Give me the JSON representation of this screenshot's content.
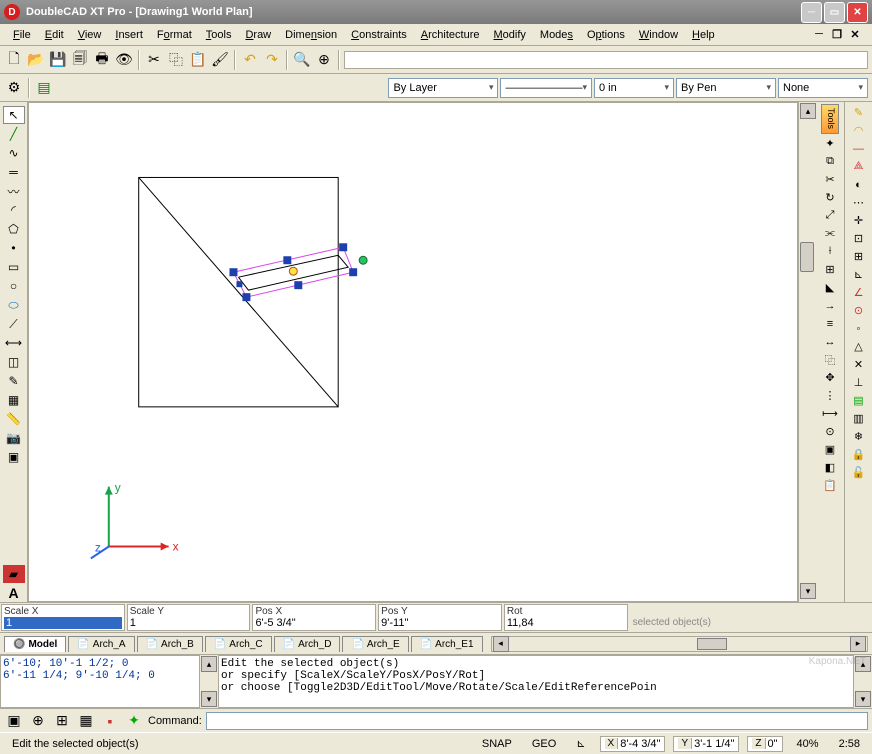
{
  "title": "DoubleCAD XT Pro - [Drawing1 World Plan]",
  "menu": [
    "File",
    "Edit",
    "View",
    "Insert",
    "Format",
    "Tools",
    "Draw",
    "Dimension",
    "Constraints",
    "Architecture",
    "Modify",
    "Modes",
    "Options",
    "Window",
    "Help"
  ],
  "props": {
    "layer": "By Layer",
    "ltype": "———————",
    "lweight": "0 in",
    "pen": "By Pen",
    "style": "None"
  },
  "params": [
    {
      "label": "Scale X",
      "value": "1"
    },
    {
      "label": "Scale Y",
      "value": "1"
    },
    {
      "label": "Pos X",
      "value": "6'-5 3/4\""
    },
    {
      "label": "Pos Y",
      "value": "9'-11\""
    },
    {
      "label": "Rot",
      "value": "11,84"
    }
  ],
  "params_hint": "selected object(s)",
  "tabs": [
    "Model",
    "Arch_A",
    "Arch_B",
    "Arch_C",
    "Arch_D",
    "Arch_E",
    "Arch_E1"
  ],
  "active_tab": "Model",
  "history": [
    "6'-10; 10'-1 1/2; 0",
    "6'-11 1/4; 9'-10 1/4; 0"
  ],
  "log": [
    "Edit the selected object(s)",
    "  or specify [ScaleX/ScaleY/PosX/PosY/Rot]",
    "  or choose [Toggle2D3D/EditTool/Move/Rotate/Scale/EditReferencePoin"
  ],
  "cmd_label": "Command:",
  "status": {
    "hint": "Edit the selected object(s)",
    "snap": "SNAP",
    "geo": "GEO",
    "x": "8'-4 3/4\"",
    "y": "3'-1 1/4\"",
    "z": "0\"",
    "zoom": "40%",
    "time": "2:58"
  },
  "axes": {
    "x": "x",
    "y": "y",
    "z": "z"
  },
  "tools_tab": "Tools"
}
